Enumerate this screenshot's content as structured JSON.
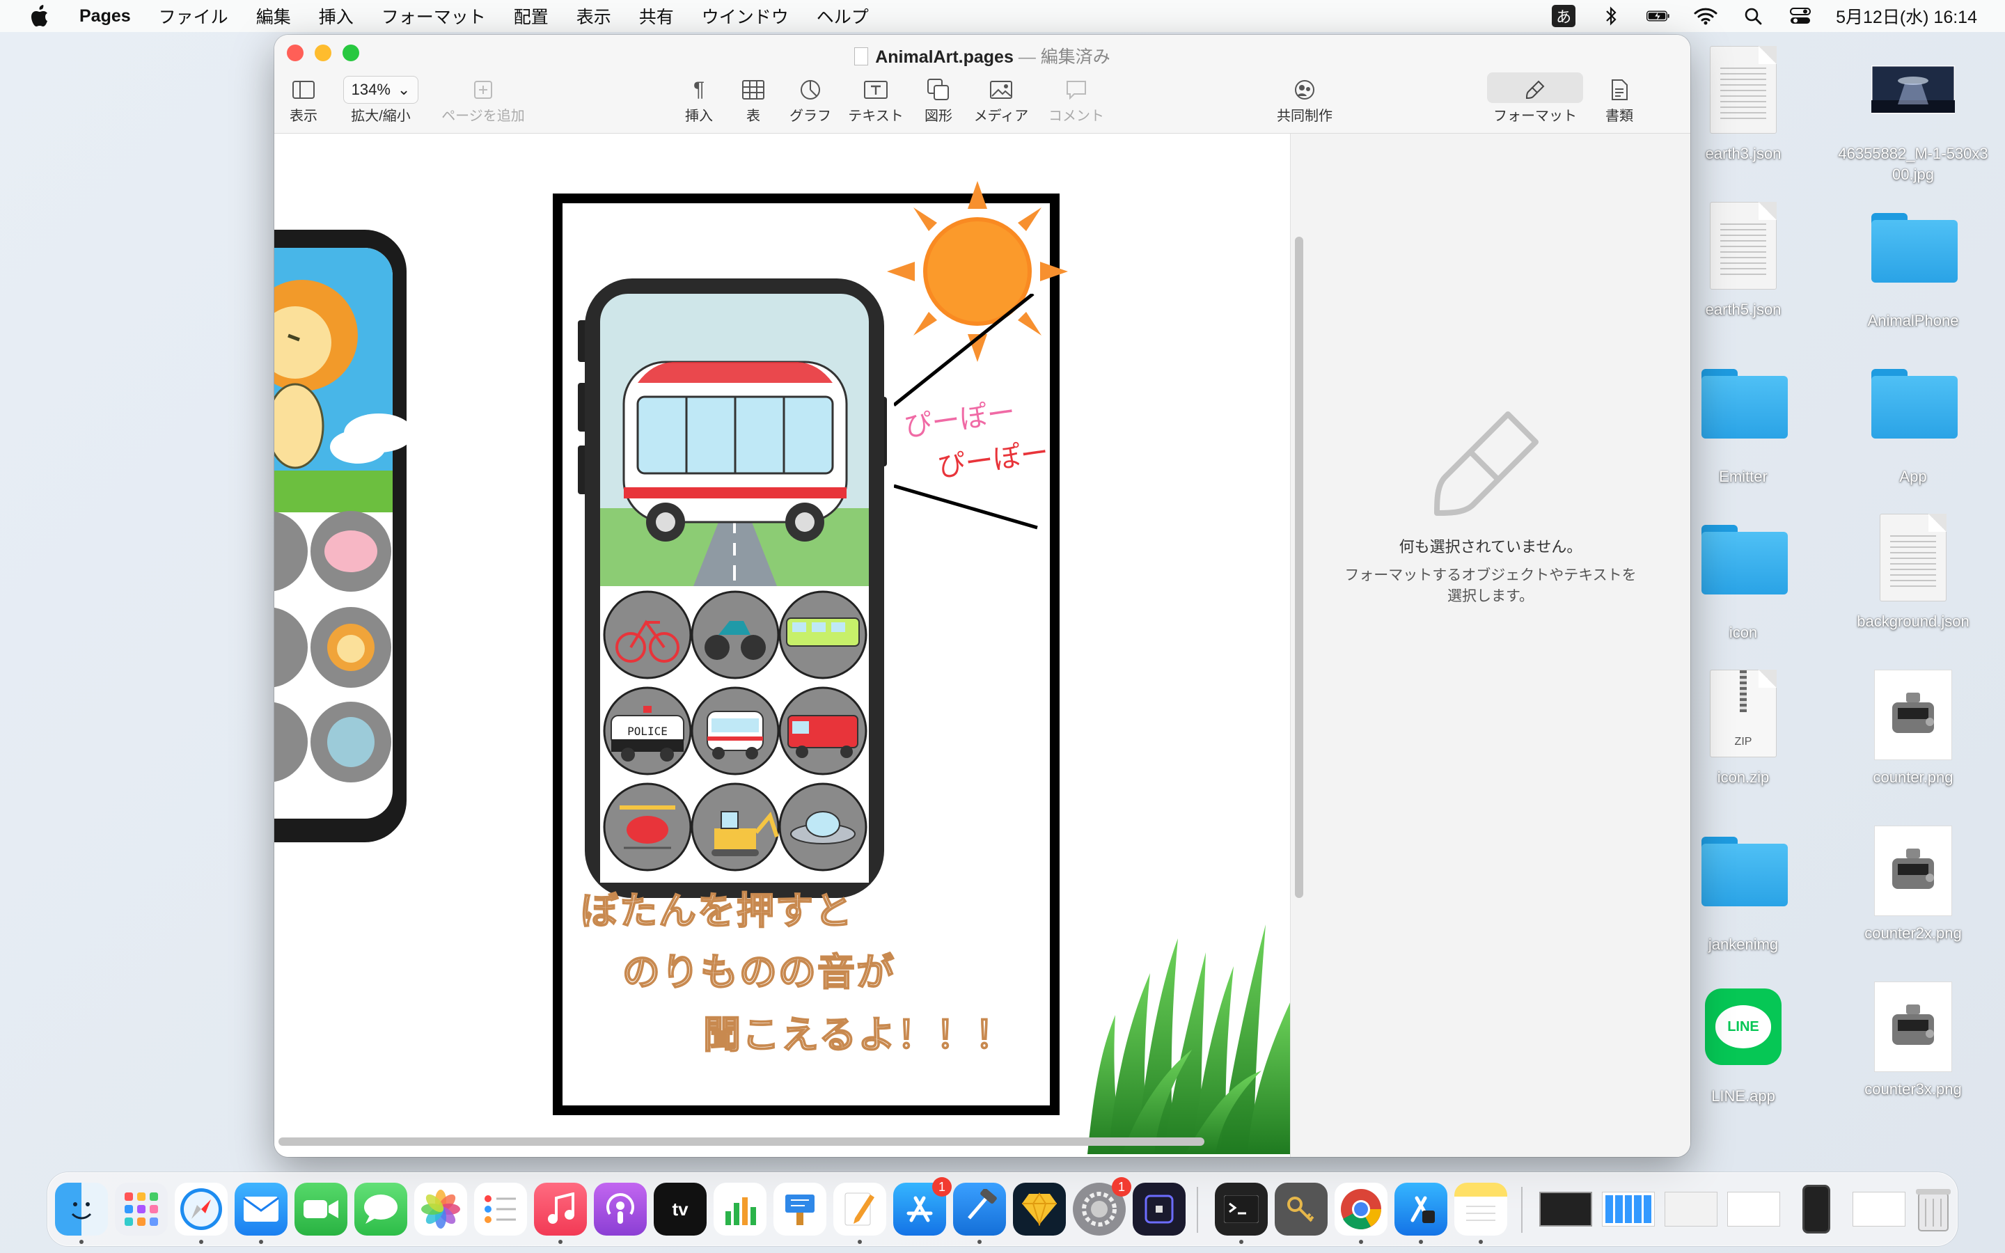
{
  "menubar": {
    "app_name": "Pages",
    "items": [
      "ファイル",
      "編集",
      "挿入",
      "フォーマット",
      "配置",
      "表示",
      "共有",
      "ウインドウ",
      "ヘルプ"
    ],
    "ime": "あ",
    "datetime": "5月12日(水) 16:14"
  },
  "window": {
    "filename": "AnimalArt.pages",
    "separator": "—",
    "status": "編集済み",
    "toolbar": {
      "view": "表示",
      "zoom_value": "134%",
      "zoom": "拡大/縮小",
      "add_page": "ページを追加",
      "insert": "挿入",
      "table": "表",
      "chart": "グラフ",
      "text": "テキスト",
      "shape": "図形",
      "media": "メディア",
      "comment": "コメント",
      "collaborate": "共同制作",
      "format": "フォーマット",
      "document": "書類"
    },
    "sidebar": {
      "heading": "何も選択されていません。",
      "hint_line1": "フォーマットするオブジェクトやテキストを",
      "hint_line2": "選択します。"
    },
    "doc": {
      "sound_line1": "ぴーぽー",
      "sound_line2": "ぴーぽー",
      "caption_line1": "ぼたんを押すと",
      "caption_line2": "のりものの音が",
      "caption_line3": "聞こえるよ！！！",
      "police_label": "POLICE"
    }
  },
  "desktop": {
    "items": [
      {
        "name": "earth3.json",
        "kind": "json"
      },
      {
        "name": "46355882_M-1-530x300.jpg",
        "kind": "image"
      },
      {
        "name": "earth5.json",
        "kind": "json"
      },
      {
        "name": "AnimalPhone",
        "kind": "folder"
      },
      {
        "name": "Emitter",
        "kind": "folder"
      },
      {
        "name": "App",
        "kind": "folder"
      },
      {
        "name": "icon",
        "kind": "folder"
      },
      {
        "name": "background.json",
        "kind": "json"
      },
      {
        "name": "icon.zip",
        "kind": "zip"
      },
      {
        "name": "counter.png",
        "kind": "png"
      },
      {
        "name": "jankenimg",
        "kind": "folder"
      },
      {
        "name": "counter2x.png",
        "kind": "png"
      },
      {
        "name": "LINE.app",
        "kind": "app"
      },
      {
        "name": "counter3x.png",
        "kind": "png"
      }
    ],
    "zip_label": "ZIP",
    "line_label": "LINE"
  },
  "dock": {
    "apps": [
      "Finder",
      "Launchpad",
      "Safari",
      "Mail",
      "FaceTime",
      "Messages",
      "Photos",
      "Reminders",
      "Music",
      "Podcasts",
      "TV",
      "Numbers",
      "Keynote",
      "Pages",
      "App Store",
      "Xcode",
      "Sketch",
      "System Preferences",
      "Simulator",
      "Terminal",
      "Keychain",
      "Chrome",
      "Transporter",
      "Notes"
    ],
    "badges": {
      "appstore": "1",
      "sysprefs": "1"
    },
    "tv_label": "tv"
  },
  "colors": {
    "accent_blue": "#2aa3e6",
    "sun": "#f7902f",
    "grass": "#2e9a2a",
    "caption_brown": "#c8894f",
    "pink_text": "#f06aa5",
    "red_text": "#e8343a"
  }
}
